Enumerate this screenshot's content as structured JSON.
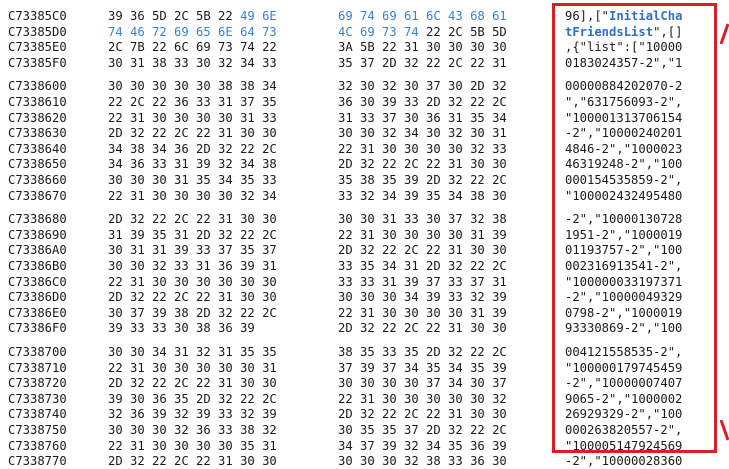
{
  "colors": {
    "highlight_box": "#d81f26",
    "hex_highlight": "#3b7fd4",
    "text": "#1b1b1b"
  },
  "icons": {
    "top_arrow": "arrow-icon",
    "bottom_arrow": "arrow-icon"
  },
  "rows": [
    {
      "addr": "C73385C0",
      "h1": "39 36 5D 2C 5B 22 ",
      "h1b": "49 6E",
      "h2a": "",
      "h2b": "69 74 69 61 6C 43 68 61",
      "a1": "96],[\"",
      "a2": "InitialCha"
    },
    {
      "addr": "C73385D0",
      "h1": "",
      "h1b": "74 46 72 69 65 6E 64 73",
      "h2a": "",
      "h2b": "4C 69 73 74",
      "h2c": " 22 2C 5B 5D",
      "a1": "",
      "a2": "tFriendsList",
      "a3": "\",[]"
    },
    {
      "addr": "C73385E0",
      "h1": "2C 7B 22 6C 69 73 74 22",
      "h2a": "3A 5B 22 31 30 30 30 30",
      "a1": ",{\"list\":[\"10000"
    },
    {
      "addr": "C73385F0",
      "h1": "30 31 38 33 30 32 34 33",
      "h2a": "35 37 2D 32 22 2C 22 31",
      "a1": "0183024357-2\",\"1"
    },
    {
      "addr": "",
      "h1": "",
      "h2a": "",
      "a1": ""
    },
    {
      "addr": "C7338600",
      "h1": "30 30 30 30 30 38 38 34",
      "h2a": "32 30 32 30 37 30 2D 32",
      "a1": "00000884202070-2"
    },
    {
      "addr": "C7338610",
      "h1": "22 2C 22 36 33 31 37 35",
      "h2a": "36 30 39 33 2D 32 22 2C",
      "a1": "\",\"631756093-2\","
    },
    {
      "addr": "C7338620",
      "h1": "22 31 30 30 30 30 31 33",
      "h2a": "31 33 37 30 36 31 35 34",
      "a1": "\"100001313706154"
    },
    {
      "addr": "C7338630",
      "h1": "2D 32 22 2C 22 31 30 30",
      "h2a": "30 30 32 34 30 32 30 31",
      "a1": "-2\",\"10000240201"
    },
    {
      "addr": "C7338640",
      "h1": "34 38 34 36 2D 32 22 2C",
      "h2a": "22 31 30 30 30 30 32 33",
      "a1": "4846-2\",\"1000023"
    },
    {
      "addr": "C7338650",
      "h1": "34 36 33 31 39 32 34 38",
      "h2a": "2D 32 22 2C 22 31 30 30",
      "a1": "46319248-2\",\"100"
    },
    {
      "addr": "C7338660",
      "h1": "30 30 30 31 35 34 35 33",
      "h2a": "35 38 35 39 2D 32 22 2C",
      "a1": "000154535859-2\","
    },
    {
      "addr": "C7338670",
      "h1": "22 31 30 30 30 30 32 34",
      "h2a": "33 32 34 39 35 34 38 30",
      "a1": "\"100002432495480"
    },
    {
      "addr": "",
      "h1": "",
      "h2a": "",
      "a1": ""
    },
    {
      "addr": "C7338680",
      "h1": "2D 32 22 2C 22 31 30 30",
      "h2a": "30 30 31 33 30 37 32 38",
      "a1": "-2\",\"10000130728"
    },
    {
      "addr": "C7338690",
      "h1": "31 39 35 31 2D 32 22 2C",
      "h2a": "22 31 30 30 30 30 31 39",
      "a1": "1951-2\",\"1000019"
    },
    {
      "addr": "C73386A0",
      "h1": "30 31 31 39 33 37 35 37",
      "h2a": "2D 32 22 2C 22 31 30 30",
      "a1": "01193757-2\",\"100"
    },
    {
      "addr": "C73386B0",
      "h1": "30 30 32 33 31 36 39 31",
      "h2a": "33 35 34 31 2D 32 22 2C",
      "a1": "002316913541-2\","
    },
    {
      "addr": "C73386C0",
      "h1": "22 31 30 30 30 30 30 30",
      "h2a": "33 33 31 39 37 33 37 31",
      "a1": "\"100000033197371"
    },
    {
      "addr": "C73386D0",
      "h1": "2D 32 22 2C 22 31 30 30",
      "h2a": "30 30 30 34 39 33 32 39",
      "a1": "-2\",\"10000049329"
    },
    {
      "addr": "C73386E0",
      "h1": "30 37 39 38 2D 32 22 2C",
      "h2a": "22 31 30 30 30 30 31 39",
      "a1": "0798-2\",\"1000019"
    },
    {
      "addr": "C73386F0",
      "h1": "39 33 33 30 38 36 39",
      "h2a": "2D 32 22 2C 22 31 30 30",
      "a1": "93330869-2\",\"100"
    },
    {
      "addr": "",
      "h1": "",
      "h2a": "",
      "a1": ""
    },
    {
      "addr": "C7338700",
      "h1": "30 30 34 31 32 31 35 35",
      "h2a": "38 35 33 35 2D 32 22 2C",
      "a1": "004121558535-2\","
    },
    {
      "addr": "C7338710",
      "h1": "22 31 30 30 30 30 30 31",
      "h2a": "37 39 37 34 35 34 35 39",
      "a1": "\"100000179745459"
    },
    {
      "addr": "C7338720",
      "h1": "2D 32 22 2C 22 31 30 30",
      "h2a": "30 30 30 30 37 34 30 37",
      "a1": "-2\",\"10000007407"
    },
    {
      "addr": "C7338730",
      "h1": "39 30 36 35 2D 32 22 2C",
      "h2a": "22 31 30 30 30 30 30 32",
      "a1": "9065-2\",\"1000002"
    },
    {
      "addr": "C7338740",
      "h1": "32 36 39 32 39 33 32 39",
      "h2a": "2D 32 22 2C 22 31 30 30",
      "a1": "26929329-2\",\"100"
    },
    {
      "addr": "C7338750",
      "h1": "30 30 30 32 36 33 38 32",
      "h2a": "30 35 35 37 2D 32 22 2C",
      "a1": "000263820557-2\","
    },
    {
      "addr": "C7338760",
      "h1": "22 31 30 30 30 30 35 31",
      "h2a": "34 37 39 32 34 35 36 39",
      "a1": "\"100005147924569"
    },
    {
      "addr": "C7338770",
      "h1": "2D 32 22 2C 22 31 30 30",
      "h2a": "30 30 30 32 38 33 36 30",
      "a1": "-2\",\"10000028360"
    }
  ]
}
